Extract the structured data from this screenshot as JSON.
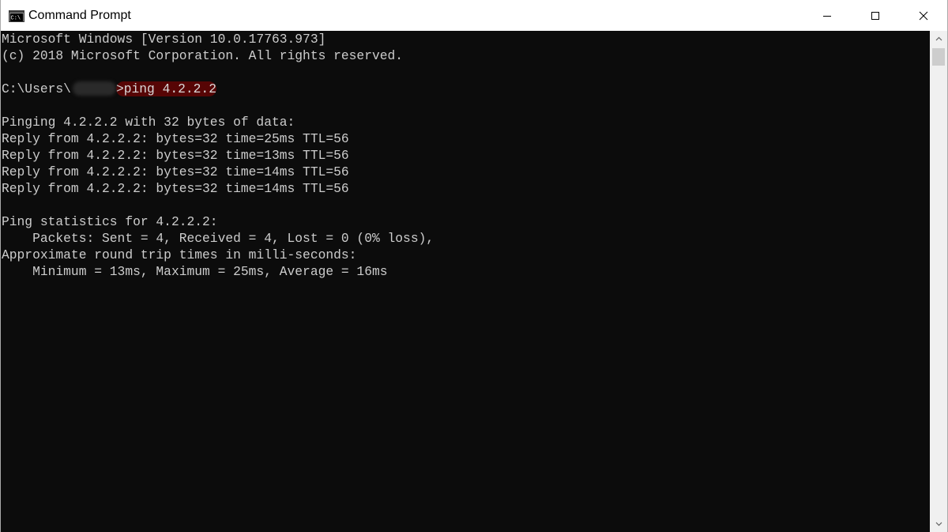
{
  "window": {
    "title": "Command Prompt",
    "app_icon": "cmd-icon",
    "controls": {
      "minimize_icon": "minimize-icon",
      "maximize_icon": "maximize-icon",
      "close_icon": "close-icon"
    }
  },
  "console": {
    "lines": [
      "Microsoft Windows [Version 10.0.17763.973]",
      "(c) 2018 Microsoft Corporation. All rights reserved.",
      "",
      "",
      "",
      "Pinging 4.2.2.2 with 32 bytes of data:",
      "Reply from 4.2.2.2: bytes=32 time=25ms TTL=56",
      "Reply from 4.2.2.2: bytes=32 time=13ms TTL=56",
      "Reply from 4.2.2.2: bytes=32 time=14ms TTL=56",
      "Reply from 4.2.2.2: bytes=32 time=14ms TTL=56",
      "",
      "Ping statistics for 4.2.2.2:",
      "    Packets: Sent = 4, Received = 4, Lost = 0 (0% loss),",
      "Approximate round trip times in milli-seconds:",
      "    Minimum = 13ms, Maximum = 25ms, Average = 16ms"
    ],
    "prompt": {
      "path_prefix": "C:\\Users\\",
      "separator": ">",
      "command": "ping 4.2.2.2"
    }
  },
  "colors": {
    "console_bg": "#0c0c0c",
    "console_text": "#cccccc",
    "highlight": "#8b0000",
    "titlebar_bg": "#ffffff"
  },
  "scrollbar": {
    "up_icon": "scroll-up-icon",
    "down_icon": "scroll-down-icon"
  }
}
